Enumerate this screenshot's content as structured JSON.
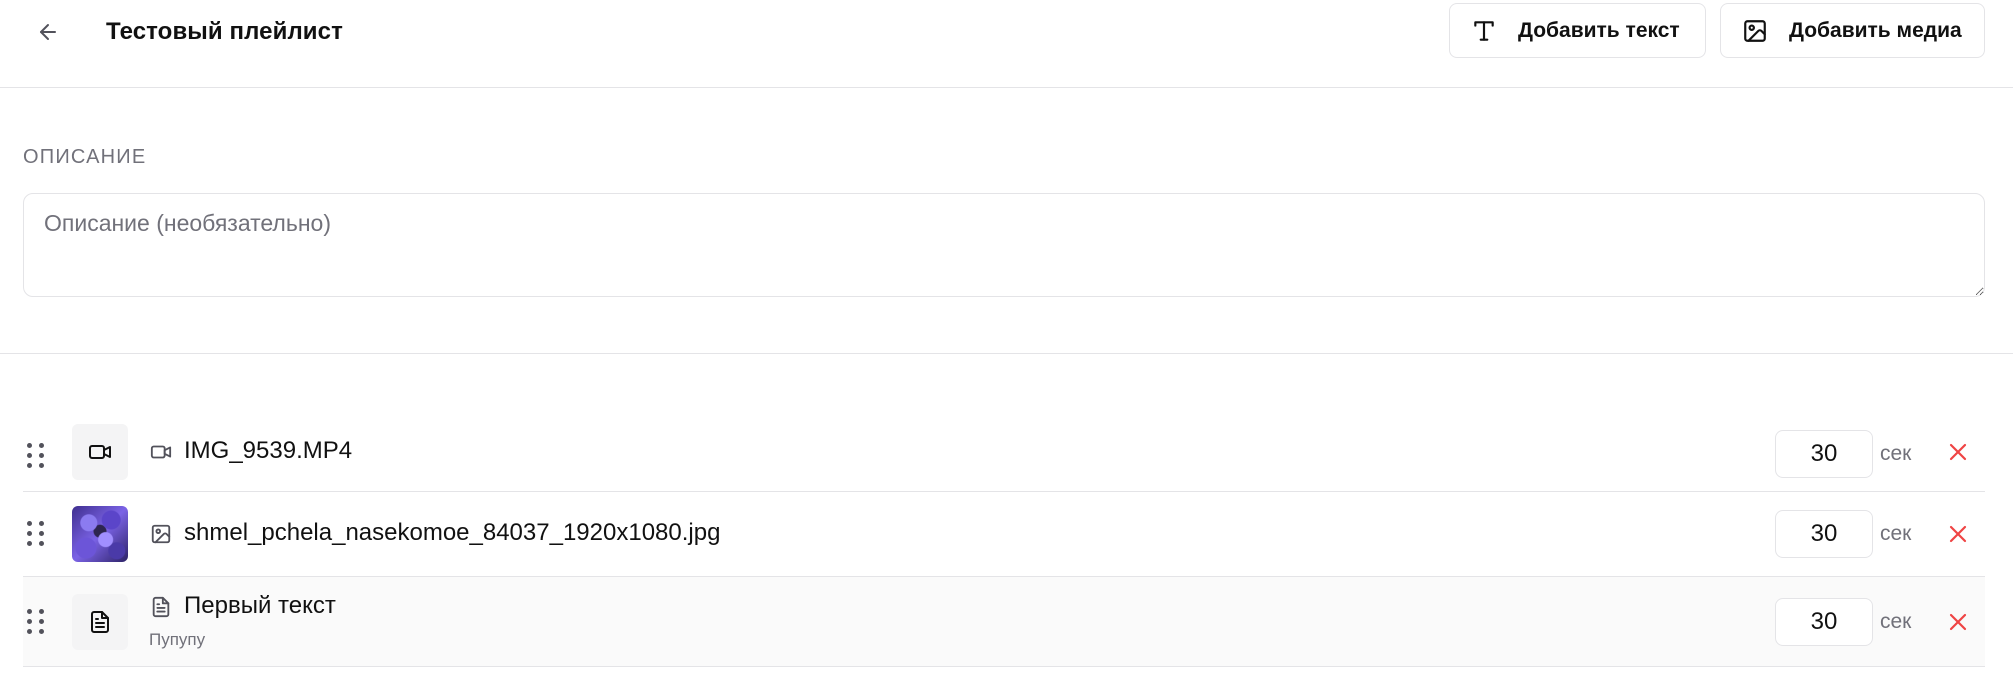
{
  "header": {
    "title": "Тестовый плейлист",
    "add_text_label": "Добавить текст",
    "add_media_label": "Добавить медиа"
  },
  "description": {
    "label": "ОПИСАНИЕ",
    "value": "",
    "placeholder": "Описание (необязательно)"
  },
  "items": [
    {
      "type": "video",
      "icon": "video-icon",
      "name": "IMG_9539.MP4",
      "subtitle": "",
      "duration": "30",
      "unit": "сек"
    },
    {
      "type": "image",
      "icon": "image-icon",
      "name": "shmel_pchela_nasekomoe_84037_1920x1080.jpg",
      "subtitle": "",
      "duration": "30",
      "unit": "сек"
    },
    {
      "type": "text",
      "icon": "document-icon",
      "name": "Первый текст",
      "subtitle": "Пупупу",
      "duration": "30",
      "unit": "сек"
    }
  ],
  "colors": {
    "border": "#e4e4e7",
    "muted_text": "#71717a",
    "delete_red": "#ef4444",
    "row_highlight": "#fafafa"
  }
}
